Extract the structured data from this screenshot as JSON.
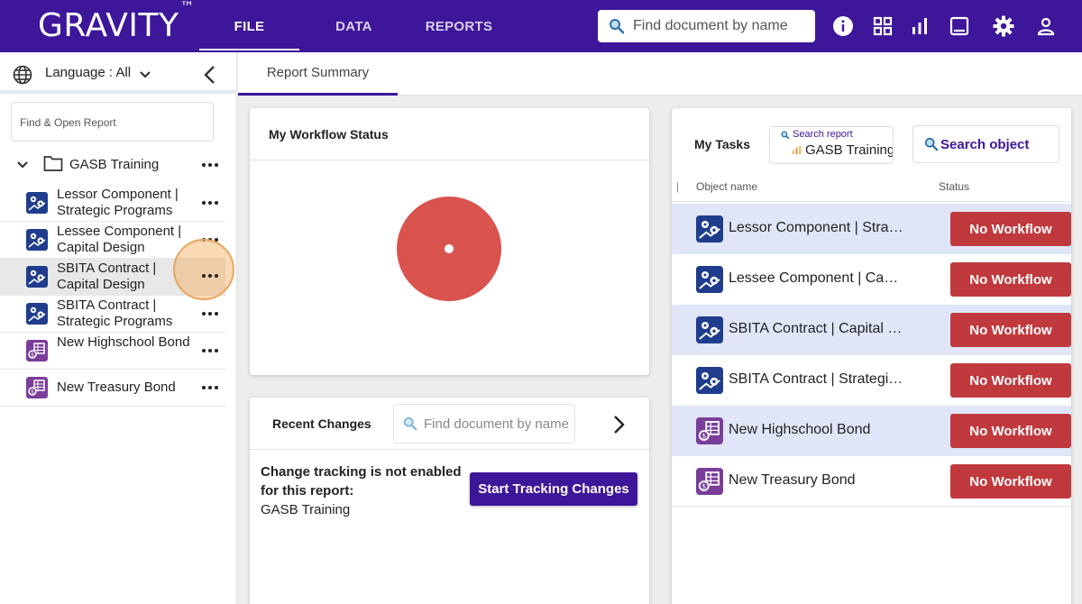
{
  "app": {
    "logo_text": "GRAVITY",
    "logo_mark": "™"
  },
  "top_nav": [
    "FILE",
    "DATA",
    "REPORTS"
  ],
  "top_search": {
    "placeholder": "Find document by name"
  },
  "toolbar_icons": [
    "info-icon",
    "grid-icon",
    "bar-chart-icon",
    "book-icon",
    "gear-icon",
    "user-icon"
  ],
  "sidebar": {
    "language_label": "Language : All",
    "find_placeholder": "Find & Open Report",
    "root": {
      "label": "GASB Training"
    },
    "items": [
      {
        "label": "Lessor Component | Strategic Programs",
        "icon": "component-icon"
      },
      {
        "label": "Lessee Component | Capital Design",
        "icon": "component-icon"
      },
      {
        "label": "SBITA Contract | Capital Design",
        "icon": "component-icon",
        "selected": true
      },
      {
        "label": "SBITA Contract | Strategic Programs",
        "icon": "component-icon"
      },
      {
        "label": "New Highschool Bond",
        "icon": "bond-icon"
      },
      {
        "label": "New Treasury Bond",
        "icon": "bond-icon"
      }
    ]
  },
  "tabs": {
    "active": "Report Summary"
  },
  "workflow_card": {
    "title": "My Workflow Status"
  },
  "recent_changes": {
    "title": "Recent Changes",
    "search_placeholder": "Find document by name",
    "message_bold": "Change tracking is not enabled for this report:",
    "message_report": "GASB Training",
    "button_label": "Start Tracking Changes"
  },
  "tasks": {
    "title": "My Tasks",
    "search_report_label": "Search report",
    "search_report_value": "GASB Training",
    "search_object_label": "Search object",
    "col_object": "Object name",
    "col_status": "Status",
    "rows": [
      {
        "name": "Lessor Component | Strat...",
        "status": "No Workflow",
        "icon": "component-icon"
      },
      {
        "name": "Lessee Component | Capit...",
        "status": "No Workflow",
        "icon": "component-icon"
      },
      {
        "name": "SBITA Contract | Capital D...",
        "status": "No Workflow",
        "icon": "component-icon"
      },
      {
        "name": "SBITA Contract | Strategic...",
        "status": "No Workflow",
        "icon": "component-icon"
      },
      {
        "name": "New Highschool Bond",
        "status": "No Workflow",
        "icon": "bond-icon"
      },
      {
        "name": "New Treasury Bond",
        "status": "No Workflow",
        "icon": "bond-icon"
      }
    ]
  },
  "colors": {
    "brand": "#3d169a",
    "no_workflow": "#c0393d",
    "workflow_pie": "#d9534f"
  }
}
